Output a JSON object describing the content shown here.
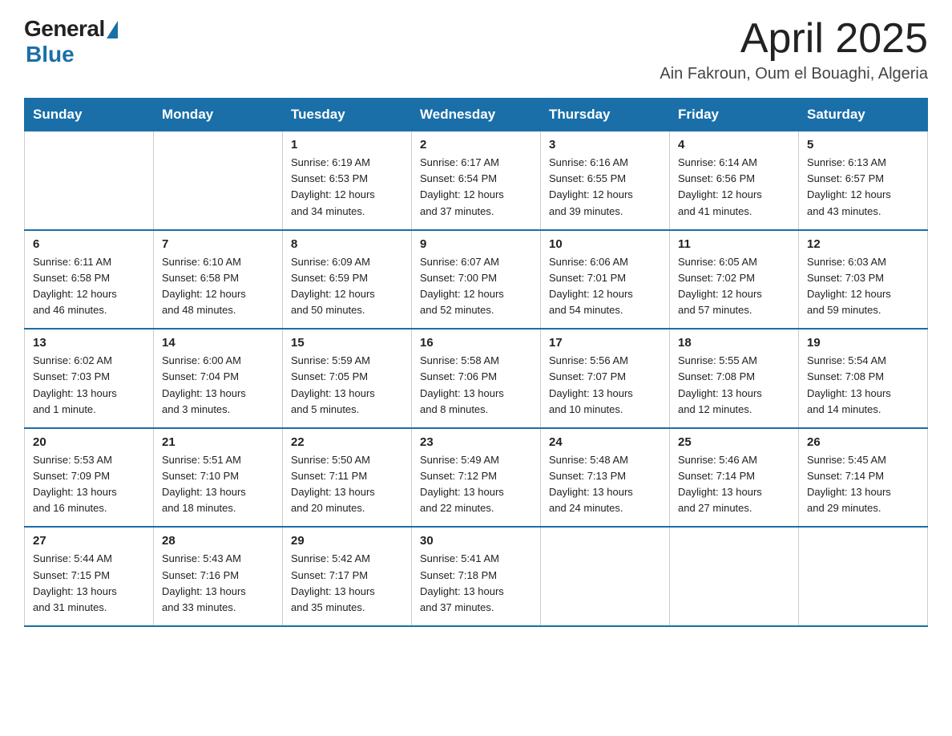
{
  "logo": {
    "general": "General",
    "blue": "Blue"
  },
  "title": "April 2025",
  "location": "Ain Fakroun, Oum el Bouaghi, Algeria",
  "weekdays": [
    "Sunday",
    "Monday",
    "Tuesday",
    "Wednesday",
    "Thursday",
    "Friday",
    "Saturday"
  ],
  "weeks": [
    [
      {
        "day": "",
        "info": ""
      },
      {
        "day": "",
        "info": ""
      },
      {
        "day": "1",
        "info": "Sunrise: 6:19 AM\nSunset: 6:53 PM\nDaylight: 12 hours\nand 34 minutes."
      },
      {
        "day": "2",
        "info": "Sunrise: 6:17 AM\nSunset: 6:54 PM\nDaylight: 12 hours\nand 37 minutes."
      },
      {
        "day": "3",
        "info": "Sunrise: 6:16 AM\nSunset: 6:55 PM\nDaylight: 12 hours\nand 39 minutes."
      },
      {
        "day": "4",
        "info": "Sunrise: 6:14 AM\nSunset: 6:56 PM\nDaylight: 12 hours\nand 41 minutes."
      },
      {
        "day": "5",
        "info": "Sunrise: 6:13 AM\nSunset: 6:57 PM\nDaylight: 12 hours\nand 43 minutes."
      }
    ],
    [
      {
        "day": "6",
        "info": "Sunrise: 6:11 AM\nSunset: 6:58 PM\nDaylight: 12 hours\nand 46 minutes."
      },
      {
        "day": "7",
        "info": "Sunrise: 6:10 AM\nSunset: 6:58 PM\nDaylight: 12 hours\nand 48 minutes."
      },
      {
        "day": "8",
        "info": "Sunrise: 6:09 AM\nSunset: 6:59 PM\nDaylight: 12 hours\nand 50 minutes."
      },
      {
        "day": "9",
        "info": "Sunrise: 6:07 AM\nSunset: 7:00 PM\nDaylight: 12 hours\nand 52 minutes."
      },
      {
        "day": "10",
        "info": "Sunrise: 6:06 AM\nSunset: 7:01 PM\nDaylight: 12 hours\nand 54 minutes."
      },
      {
        "day": "11",
        "info": "Sunrise: 6:05 AM\nSunset: 7:02 PM\nDaylight: 12 hours\nand 57 minutes."
      },
      {
        "day": "12",
        "info": "Sunrise: 6:03 AM\nSunset: 7:03 PM\nDaylight: 12 hours\nand 59 minutes."
      }
    ],
    [
      {
        "day": "13",
        "info": "Sunrise: 6:02 AM\nSunset: 7:03 PM\nDaylight: 13 hours\nand 1 minute."
      },
      {
        "day": "14",
        "info": "Sunrise: 6:00 AM\nSunset: 7:04 PM\nDaylight: 13 hours\nand 3 minutes."
      },
      {
        "day": "15",
        "info": "Sunrise: 5:59 AM\nSunset: 7:05 PM\nDaylight: 13 hours\nand 5 minutes."
      },
      {
        "day": "16",
        "info": "Sunrise: 5:58 AM\nSunset: 7:06 PM\nDaylight: 13 hours\nand 8 minutes."
      },
      {
        "day": "17",
        "info": "Sunrise: 5:56 AM\nSunset: 7:07 PM\nDaylight: 13 hours\nand 10 minutes."
      },
      {
        "day": "18",
        "info": "Sunrise: 5:55 AM\nSunset: 7:08 PM\nDaylight: 13 hours\nand 12 minutes."
      },
      {
        "day": "19",
        "info": "Sunrise: 5:54 AM\nSunset: 7:08 PM\nDaylight: 13 hours\nand 14 minutes."
      }
    ],
    [
      {
        "day": "20",
        "info": "Sunrise: 5:53 AM\nSunset: 7:09 PM\nDaylight: 13 hours\nand 16 minutes."
      },
      {
        "day": "21",
        "info": "Sunrise: 5:51 AM\nSunset: 7:10 PM\nDaylight: 13 hours\nand 18 minutes."
      },
      {
        "day": "22",
        "info": "Sunrise: 5:50 AM\nSunset: 7:11 PM\nDaylight: 13 hours\nand 20 minutes."
      },
      {
        "day": "23",
        "info": "Sunrise: 5:49 AM\nSunset: 7:12 PM\nDaylight: 13 hours\nand 22 minutes."
      },
      {
        "day": "24",
        "info": "Sunrise: 5:48 AM\nSunset: 7:13 PM\nDaylight: 13 hours\nand 24 minutes."
      },
      {
        "day": "25",
        "info": "Sunrise: 5:46 AM\nSunset: 7:14 PM\nDaylight: 13 hours\nand 27 minutes."
      },
      {
        "day": "26",
        "info": "Sunrise: 5:45 AM\nSunset: 7:14 PM\nDaylight: 13 hours\nand 29 minutes."
      }
    ],
    [
      {
        "day": "27",
        "info": "Sunrise: 5:44 AM\nSunset: 7:15 PM\nDaylight: 13 hours\nand 31 minutes."
      },
      {
        "day": "28",
        "info": "Sunrise: 5:43 AM\nSunset: 7:16 PM\nDaylight: 13 hours\nand 33 minutes."
      },
      {
        "day": "29",
        "info": "Sunrise: 5:42 AM\nSunset: 7:17 PM\nDaylight: 13 hours\nand 35 minutes."
      },
      {
        "day": "30",
        "info": "Sunrise: 5:41 AM\nSunset: 7:18 PM\nDaylight: 13 hours\nand 37 minutes."
      },
      {
        "day": "",
        "info": ""
      },
      {
        "day": "",
        "info": ""
      },
      {
        "day": "",
        "info": ""
      }
    ]
  ]
}
